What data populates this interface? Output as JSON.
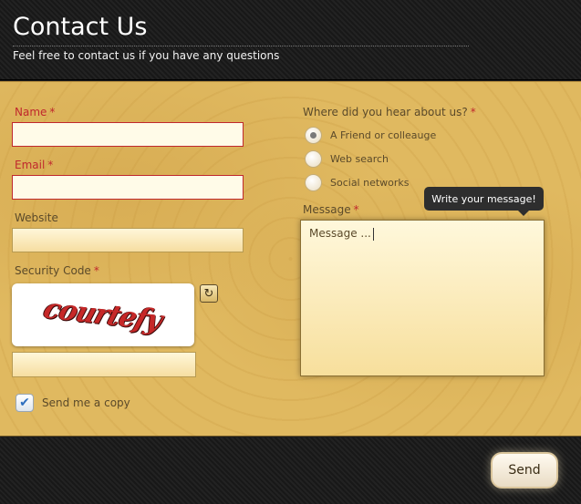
{
  "header": {
    "title": "Contact Us",
    "subtitle": "Feel free to contact us if you have any questions"
  },
  "form": {
    "name_label": "Name",
    "email_label": "Email",
    "website_label": "Website",
    "security_label": "Security Code",
    "captcha_text": "courtefy",
    "send_copy_label": "Send me a copy",
    "send_copy_checked": true,
    "required_mark": "*",
    "hear_label": "Where did you hear about us?",
    "hear_options": [
      "A Friend or colleauge",
      "Web search",
      "Social networks"
    ],
    "hear_selected": "A Friend or colleauge",
    "message_label": "Message",
    "message_value": "Message ...",
    "tooltip": "Write your message!",
    "refresh_icon": "refresh-icon",
    "check_icon": "checkmark-icon"
  },
  "footer": {
    "send_label": "Send"
  },
  "colors": {
    "panel": "#e0b960",
    "required": "#c0282d",
    "header_bg": "#1c1c1c"
  }
}
